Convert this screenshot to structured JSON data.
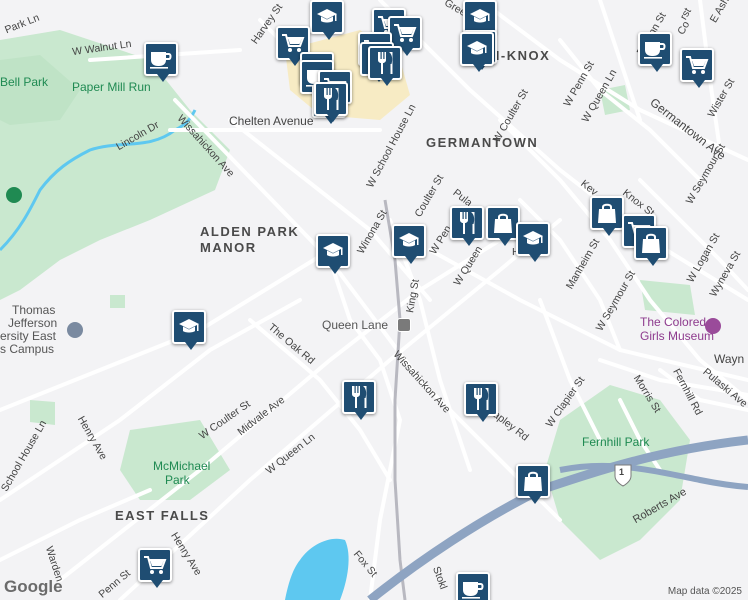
{
  "map": {
    "areas": {
      "germantown": "GERMANTOWN",
      "alden_park_1": "ALDEN PARK",
      "alden_park_2": "MANOR",
      "east_falls": "EAST FALLS",
      "penn_knox": "N-KNOX"
    },
    "streets": {
      "park_ln": "Park Ln",
      "w_walnut_ln": "W Walnut Ln",
      "harvey_st": "Harvey St",
      "greene_st": "Greene St",
      "wissahickon_ave_1": "Wissahickon Ave",
      "wissahickon_ave_2": "Wissahickon Ave",
      "lincoln_dr": "Lincoln Dr",
      "chelten_ave": "Chelten Avenue",
      "w_school_house_ln_1": "W School House Ln",
      "w_school_house_ln_2": "School House Ln",
      "w_coulter_st_1": "W Coulter St",
      "coulter_st": "Coulter St",
      "w_coulter_st_2": "W Coulter St",
      "w_penn_st_1": "W Penn St",
      "w_penn_st_2": "W Pen",
      "w_queen_ln_1": "W Queen Ln",
      "w_queen_ln_2": "W Queen Ln",
      "w_queen_3": "W Queen",
      "e_penn_st": "E Penn St",
      "e_ash": "E Ash",
      "germantown_ave": "Germantown Ave",
      "wister_st": "Wister St",
      "w_seymour_st_1": "W Seymour St",
      "w_seymour_st_2": "W Seymour St",
      "knox_st": "Knox St",
      "kev": "Kev",
      "w_logan_st": "W Logan St",
      "wyneva_st": "Wyneva St",
      "manheim_st": "Manheim St",
      "winona_st": "Winona St",
      "pulaski_1": "Pula",
      "king_st": "King St",
      "the_oak_rd": "The Oak Rd",
      "midvale_ave": "Midvale Ave",
      "henry_ave_1": "Henry Ave",
      "henry_ave_2": "Henry Ave",
      "fox_st": "Fox St",
      "w_clapier_st": "W Clapier St",
      "fernhill_rd": "Fernhill Rd",
      "morris_st": "Morris St",
      "pulaski_ave": "Pulaski Ave",
      "roberts_ave": "Roberts Ave",
      "apley_rd": "apley Rd",
      "warden": "Warden",
      "penn_st": "Penn St",
      "stokl": "Stokl",
      "h_label": "H",
      "wayn": "Wayn",
      "co_label": "Co",
      "rst_label": "rst",
      "route_1": "1"
    },
    "parks": {
      "bell_park": "Bell Park",
      "paper_mill_run": "Paper Mill Run",
      "mcmichael_park_1": "McMichael",
      "mcmichael_park_2": "Park",
      "fernhill_park": "Fernhill Park"
    },
    "pois": {
      "jefferson_1": "Thomas",
      "jefferson_2": "Jefferson",
      "jefferson_3": "ersity East",
      "jefferson_4": "s Campus",
      "museum_1": "The Colored",
      "museum_2": "Girls Museum",
      "queen_lane": "Queen Lane"
    },
    "attribution": {
      "logo": "Google",
      "data": "Map data ©2025"
    }
  },
  "colors": {
    "background": "#f3f3f5",
    "road": "#ffffff",
    "highway": "#8ea4c2",
    "park": "#c9e8cf",
    "water": "#5ec8f0",
    "pin": "#1f4d72",
    "rail": "#b8b8c0"
  },
  "markers": [
    {
      "icon": "school-icon"
    },
    {
      "icon": "school-icon"
    },
    {
      "icon": "shopping-cart-icon"
    },
    {
      "icon": "shopping-cart-icon"
    },
    {
      "icon": "shopping-cart-icon"
    },
    {
      "icon": "school-icon"
    },
    {
      "icon": "shopping-cart-icon"
    },
    {
      "icon": "restaurant-icon"
    },
    {
      "icon": "shopping-cart-icon"
    },
    {
      "icon": "restaurant-icon"
    },
    {
      "icon": "school-icon"
    },
    {
      "icon": "coffee-icon"
    },
    {
      "icon": "coffee-icon"
    },
    {
      "icon": "shopping-cart-icon"
    },
    {
      "icon": "coffee-icon"
    },
    {
      "icon": "shopping-cart-icon"
    },
    {
      "icon": "restaurant-icon"
    },
    {
      "icon": "restaurant-icon"
    },
    {
      "icon": "school-icon"
    },
    {
      "icon": "school-icon"
    },
    {
      "icon": "restaurant-icon"
    },
    {
      "icon": "shopping-bag-icon"
    },
    {
      "icon": "school-icon"
    },
    {
      "icon": "shopping-bag-icon"
    },
    {
      "icon": "shopping-cart-icon"
    },
    {
      "icon": "shopping-bag-icon"
    },
    {
      "icon": "school-icon"
    },
    {
      "icon": "restaurant-icon"
    },
    {
      "icon": "restaurant-icon"
    },
    {
      "icon": "shopping-bag-icon"
    },
    {
      "icon": "shopping-cart-icon"
    },
    {
      "icon": "coffee-icon"
    }
  ]
}
